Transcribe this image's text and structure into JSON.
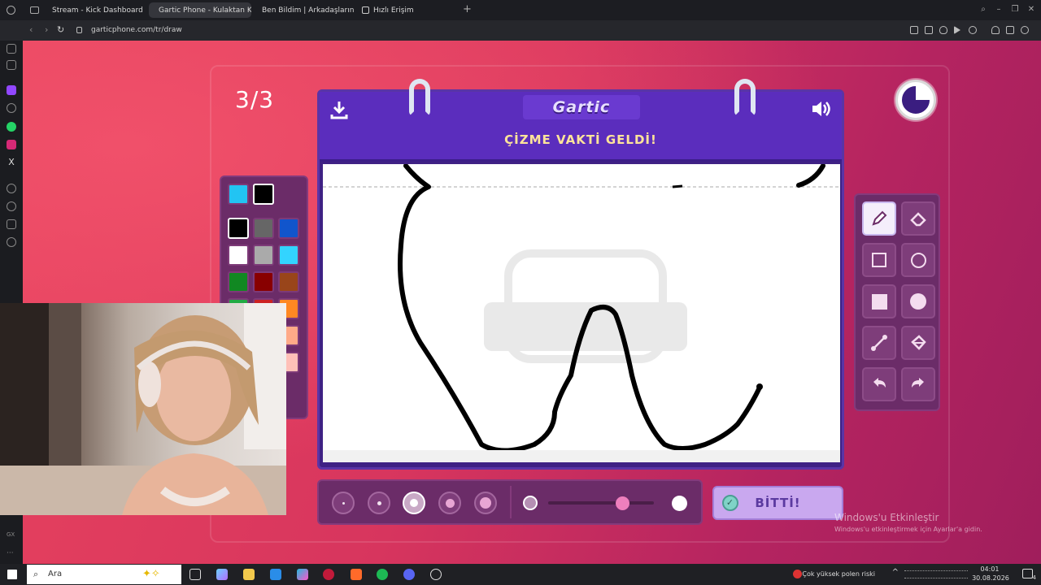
{
  "browser": {
    "tabs": [
      {
        "label": "Stream - Kick Dashboard",
        "color": "#53fc18"
      },
      {
        "label": "Gartic Phone - Kulaktan Ku",
        "color": "#ffffff"
      },
      {
        "label": "Ben Bildim | Arkadaşlarını",
        "color": "#e85a2c"
      },
      {
        "label": "Hızlı Erişim",
        "color": "#cccccc"
      }
    ],
    "url": "garticphone.com/tr/draw"
  },
  "game": {
    "round": "3/3",
    "logo": "Gartic",
    "prompt": "ÇİZME VAKTİ GELDİ!",
    "done_label": "BİTTİ!",
    "colors": {
      "primary": "#22c4f3",
      "secondary": "#000000",
      "palette": [
        "#000000",
        "#666666",
        "#1155cc",
        "#ffffff",
        "#aaaaaa",
        "#33d4ff",
        "#118822",
        "#880000",
        "#99451a",
        "#22aa44",
        "#cc2222",
        "#ff8822",
        "#66bb66",
        "#ee5555",
        "#ffaa88",
        "#eeaa99",
        "#ffbbbb",
        "#ffc0b8",
        "#000000"
      ]
    },
    "thickness_options": 5,
    "opacity_level": 0.3
  },
  "system": {
    "watermark_title": "Windows'u Etkinleştir",
    "watermark_sub": "Windows'u etkinleştirmek için Ayarlar'a gidin.",
    "search_placeholder": "Ara",
    "weather": "Çok yüksek polen riski",
    "time": "04:01",
    "date": "30.08.2026",
    "notif_count": "4"
  }
}
